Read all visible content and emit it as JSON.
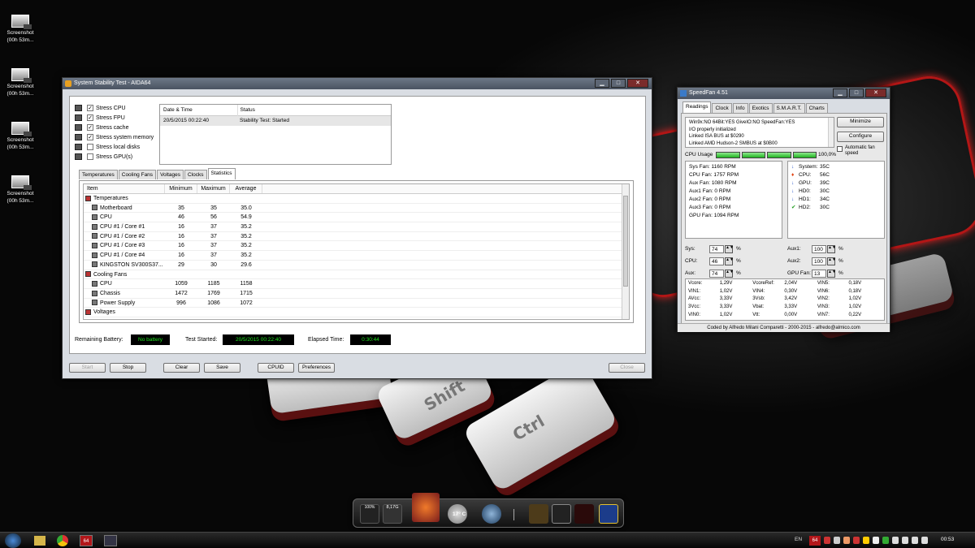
{
  "desktop": {
    "icons": [
      {
        "label": "Screenshot (00h 53m..."
      },
      {
        "label": "Screenshot (00h 53m..."
      },
      {
        "label": "Screenshot (00h 53m..."
      },
      {
        "label": "Screenshot (00h 53m..."
      }
    ]
  },
  "keyboard": {
    "shift": "Shift",
    "ctrl": "Ctrl"
  },
  "aida": {
    "title": "System Stability Test - AIDA64",
    "checks": [
      {
        "label": "Stress CPU",
        "checked": true
      },
      {
        "label": "Stress FPU",
        "checked": true
      },
      {
        "label": "Stress cache",
        "checked": true
      },
      {
        "label": "Stress system memory",
        "checked": true
      },
      {
        "label": "Stress local disks",
        "checked": false
      },
      {
        "label": "Stress GPU(s)",
        "checked": false
      }
    ],
    "log": {
      "col_date": "Date & Time",
      "col_status": "Status",
      "rows": [
        {
          "date": "20/5/2015 00:22:40",
          "status": "Stability Test: Started"
        }
      ]
    },
    "tabs": [
      "Temperatures",
      "Cooling Fans",
      "Voltages",
      "Clocks",
      "Statistics"
    ],
    "active_tab": "Statistics",
    "stats": {
      "col_item": "Item",
      "col_min": "Minimum",
      "col_max": "Maximum",
      "col_avg": "Average",
      "rows": [
        {
          "type": "group",
          "item": "Temperatures"
        },
        {
          "type": "row",
          "item": "Motherboard",
          "min": "35",
          "max": "35",
          "avg": "35.0"
        },
        {
          "type": "row",
          "item": "CPU",
          "min": "46",
          "max": "56",
          "avg": "54.9"
        },
        {
          "type": "row",
          "item": "CPU #1 / Core #1",
          "min": "16",
          "max": "37",
          "avg": "35.2"
        },
        {
          "type": "row",
          "item": "CPU #1 / Core #2",
          "min": "16",
          "max": "37",
          "avg": "35.2"
        },
        {
          "type": "row",
          "item": "CPU #1 / Core #3",
          "min": "16",
          "max": "37",
          "avg": "35.2"
        },
        {
          "type": "row",
          "item": "CPU #1 / Core #4",
          "min": "16",
          "max": "37",
          "avg": "35.2"
        },
        {
          "type": "row",
          "item": "KINGSTON SV300S37...",
          "min": "29",
          "max": "30",
          "avg": "29.6"
        },
        {
          "type": "group",
          "item": "Cooling Fans"
        },
        {
          "type": "row",
          "item": "CPU",
          "min": "1059",
          "max": "1185",
          "avg": "1158"
        },
        {
          "type": "row",
          "item": "Chassis",
          "min": "1472",
          "max": "1769",
          "avg": "1715"
        },
        {
          "type": "row",
          "item": "Power Supply",
          "min": "996",
          "max": "1086",
          "avg": "1072"
        },
        {
          "type": "group",
          "item": "Voltages"
        }
      ]
    },
    "status": {
      "battery_label": "Remaining Battery:",
      "battery": "No battery",
      "started_label": "Test Started:",
      "started": "20/5/2015 00:22:40",
      "elapsed_label": "Elapsed Time:",
      "elapsed": "0:30:44"
    },
    "buttons": {
      "start": "Start",
      "stop": "Stop",
      "clear": "Clear",
      "save": "Save",
      "cpuid": "CPUID",
      "prefs": "Preferences",
      "close": "Close"
    }
  },
  "speedfan": {
    "title": "SpeedFan 4.51",
    "tabs": [
      "Readings",
      "Clock",
      "Info",
      "Exotics",
      "S.M.A.R.T.",
      "Charts"
    ],
    "active_tab": "Readings",
    "log": [
      "Win9x:NO  64Bit:YES  GiveIO:NO  SpeedFan:YES",
      "I/O properly initialized",
      "Linked ISA BUS at $0290",
      "Linked AMD Hudson-2 SMBUS at $0B00"
    ],
    "minimize": "Minimize",
    "configure": "Configure",
    "auto_fan": "Automatic fan speed",
    "cpu_usage_label": "CPU Usage",
    "cpu_usage": "100,0%",
    "cpu_usage_fraction": 1.0,
    "fans": [
      "Sys Fan: 1160 RPM",
      "CPU Fan: 1757 RPM",
      "Aux Fan: 1080 RPM",
      "Aux1 Fan: 0 RPM",
      "Aux2 Fan: 0 RPM",
      "Aux3 Fan: 0 RPM",
      "GPU Fan: 1094 RPM"
    ],
    "temps": [
      {
        "label": "System:",
        "value": "35C",
        "icon": "arrow-down-icon"
      },
      {
        "label": "CPU:",
        "value": "56C",
        "icon": "flame-icon"
      },
      {
        "label": "GPU:",
        "value": "39C",
        "icon": "arrow-down-icon"
      },
      {
        "label": "HD0:",
        "value": "30C",
        "icon": "arrow-down-icon"
      },
      {
        "label": "HD1:",
        "value": "34C",
        "icon": "arrow-down-icon"
      },
      {
        "label": "HD2:",
        "value": "30C",
        "icon": "checkmark-icon"
      }
    ],
    "speeds_left": [
      {
        "label": "Sys:",
        "value": "74"
      },
      {
        "label": "CPU:",
        "value": "46"
      },
      {
        "label": "Aux:",
        "value": "74"
      }
    ],
    "speeds_right": [
      {
        "label": "Aux1:",
        "value": "100"
      },
      {
        "label": "Aux2:",
        "value": "100"
      },
      {
        "label": "GPU Fan:",
        "value": "13"
      }
    ],
    "percent": "%",
    "volts": [
      [
        "Vcore:",
        "1,29V",
        "VcoreRef:",
        "2,04V",
        "VIN5:",
        "0,18V"
      ],
      [
        "VIN1:",
        "1,02V",
        "VIN4:",
        "0,30V",
        "VIN6:",
        "0,18V"
      ],
      [
        "AVcc:",
        "3,33V",
        "3Vsb:",
        "3,42V",
        "VIN2:",
        "1,02V"
      ],
      [
        "3Vcc:",
        "3,33V",
        "Vbat:",
        "3,33V",
        "VIN3:",
        "1,02V"
      ],
      [
        "VIN0:",
        "1,02V",
        "Vtt:",
        "0,00V",
        "VIN7:",
        "0,22V"
      ]
    ],
    "footer": "Coded by Alfredo Milani Comparetti - 2000-2015 - alfredo@almico.com"
  },
  "dock": {
    "mem_pct": "100%",
    "mem_val": "8,17G",
    "weather": "17° C"
  },
  "taskbar": {
    "lang": "EN",
    "aida_badge": "64",
    "clock": "00:53"
  }
}
